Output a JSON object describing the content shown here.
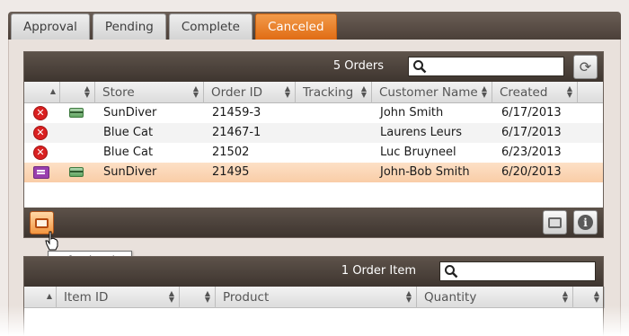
{
  "tabs": [
    {
      "label": "Approval",
      "active": false
    },
    {
      "label": "Pending",
      "active": false
    },
    {
      "label": "Complete",
      "active": false
    },
    {
      "label": "Canceled",
      "active": true
    }
  ],
  "orders": {
    "count_label": "5 Orders",
    "search_value": "",
    "columns": [
      "",
      "",
      "Store",
      "Order ID",
      "Tracking",
      "Customer Name",
      "Created"
    ],
    "rows": [
      {
        "status_icon": "cancel-icon",
        "payment_icon": "credit-card-icon",
        "store": "SunDiver",
        "order_id": "21459-3",
        "tracking": "",
        "customer": "John Smith",
        "created": "6/17/2013"
      },
      {
        "status_icon": "cancel-icon",
        "payment_icon": "",
        "store": "Blue Cat",
        "order_id": "21467-1",
        "tracking": "",
        "customer": "Laurens Leurs",
        "created": "6/17/2013"
      },
      {
        "status_icon": "cancel-icon",
        "payment_icon": "",
        "store": "Blue Cat",
        "order_id": "21502",
        "tracking": "",
        "customer": "Luc Bruyneel",
        "created": "6/23/2013"
      },
      {
        "status_icon": "refund-flag-icon",
        "payment_icon": "credit-card-icon",
        "store": "SunDiver",
        "order_id": "21495",
        "tracking": "",
        "customer": "John-Bob Smith",
        "created": "6/20/2013",
        "selected": true
      }
    ]
  },
  "footer": {
    "tooltip": "Refund Order"
  },
  "items": {
    "count_label": "1 Order Item",
    "search_value": "",
    "columns": [
      "",
      "Item ID",
      "",
      "Product",
      "Quantity",
      ""
    ]
  },
  "colors": {
    "accent": "#e87c24",
    "header": "#4b4039",
    "selected_row": "#fbd7b6",
    "cancel": "#d92020"
  }
}
